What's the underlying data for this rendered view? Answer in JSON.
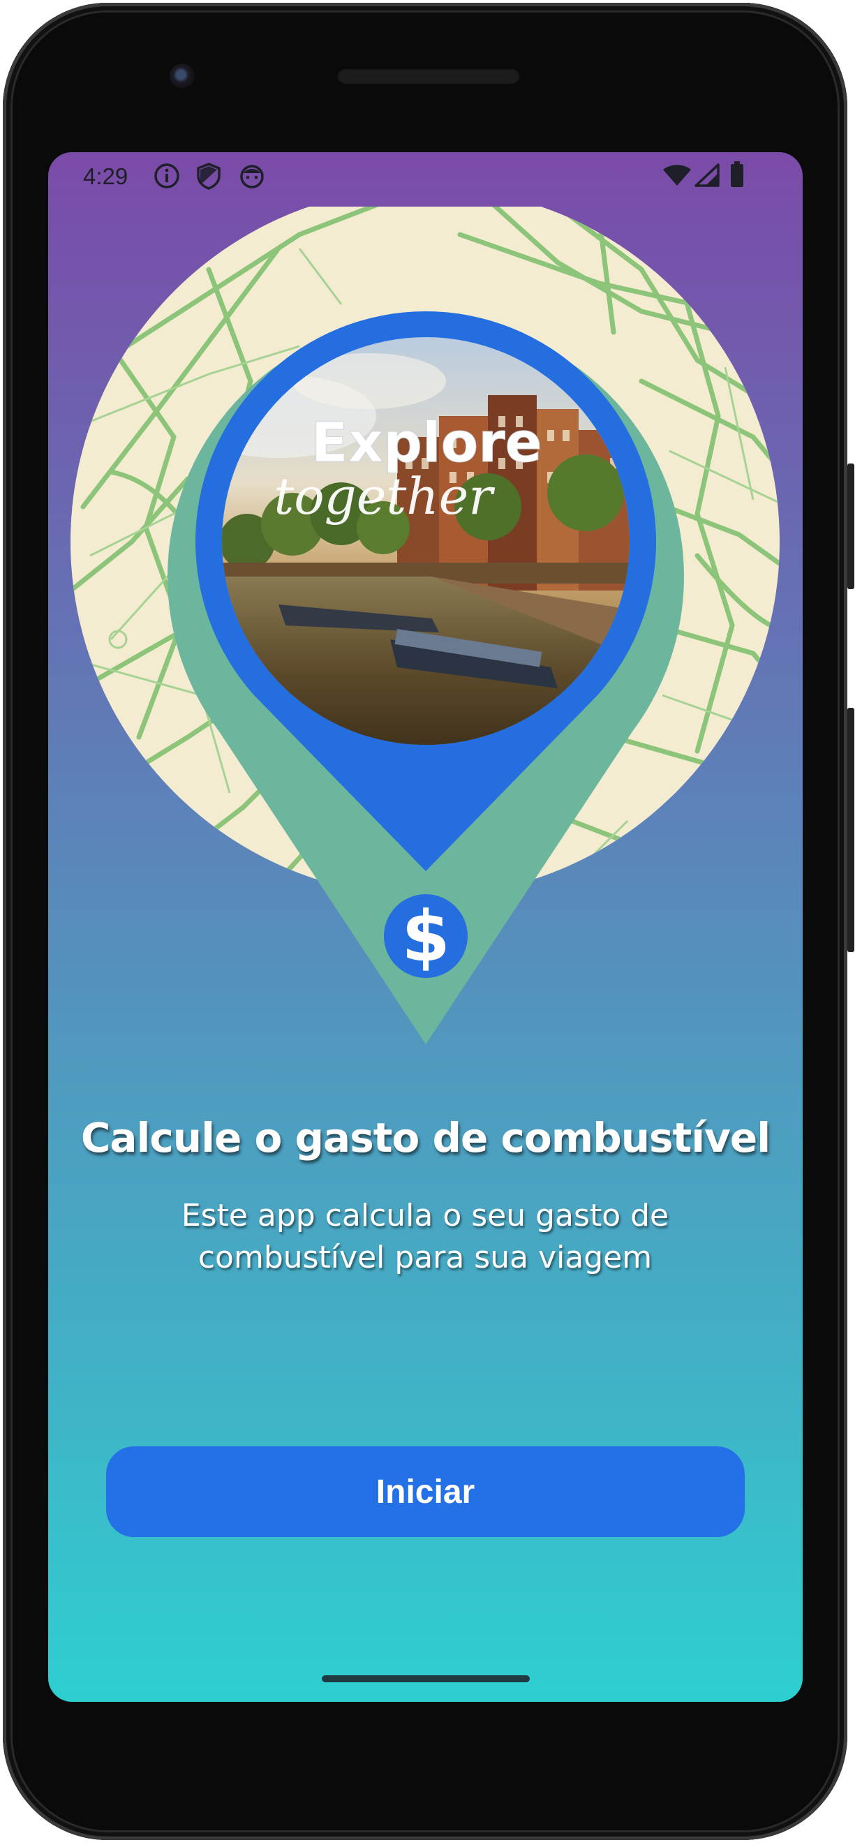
{
  "status_bar": {
    "time": "4:29",
    "left_icons": [
      "info-icon",
      "shield-icon",
      "notification-face-icon"
    ],
    "right_icons": [
      "wifi-icon",
      "cellular-signal-icon",
      "battery-icon"
    ]
  },
  "hero": {
    "image_caption_line1": "Explore",
    "image_caption_line2": "together",
    "pin_icon": "dollar-icon",
    "pin_symbol": "$",
    "colors": {
      "map_background": "#f4ecd0",
      "map_roads": "#8cc57a",
      "pin_outer": "#6cb69d",
      "pin_inner": "#246ee0"
    }
  },
  "content": {
    "title": "Calcule o gasto de combustível",
    "subtitle": "Este app calcula o seu gasto de combustível para sua viagem"
  },
  "actions": {
    "start_label": "Iniciar"
  },
  "colors": {
    "gradient_top": "#7b4ba8",
    "gradient_bottom": "#2ecfd0",
    "button": "#2470e6"
  }
}
